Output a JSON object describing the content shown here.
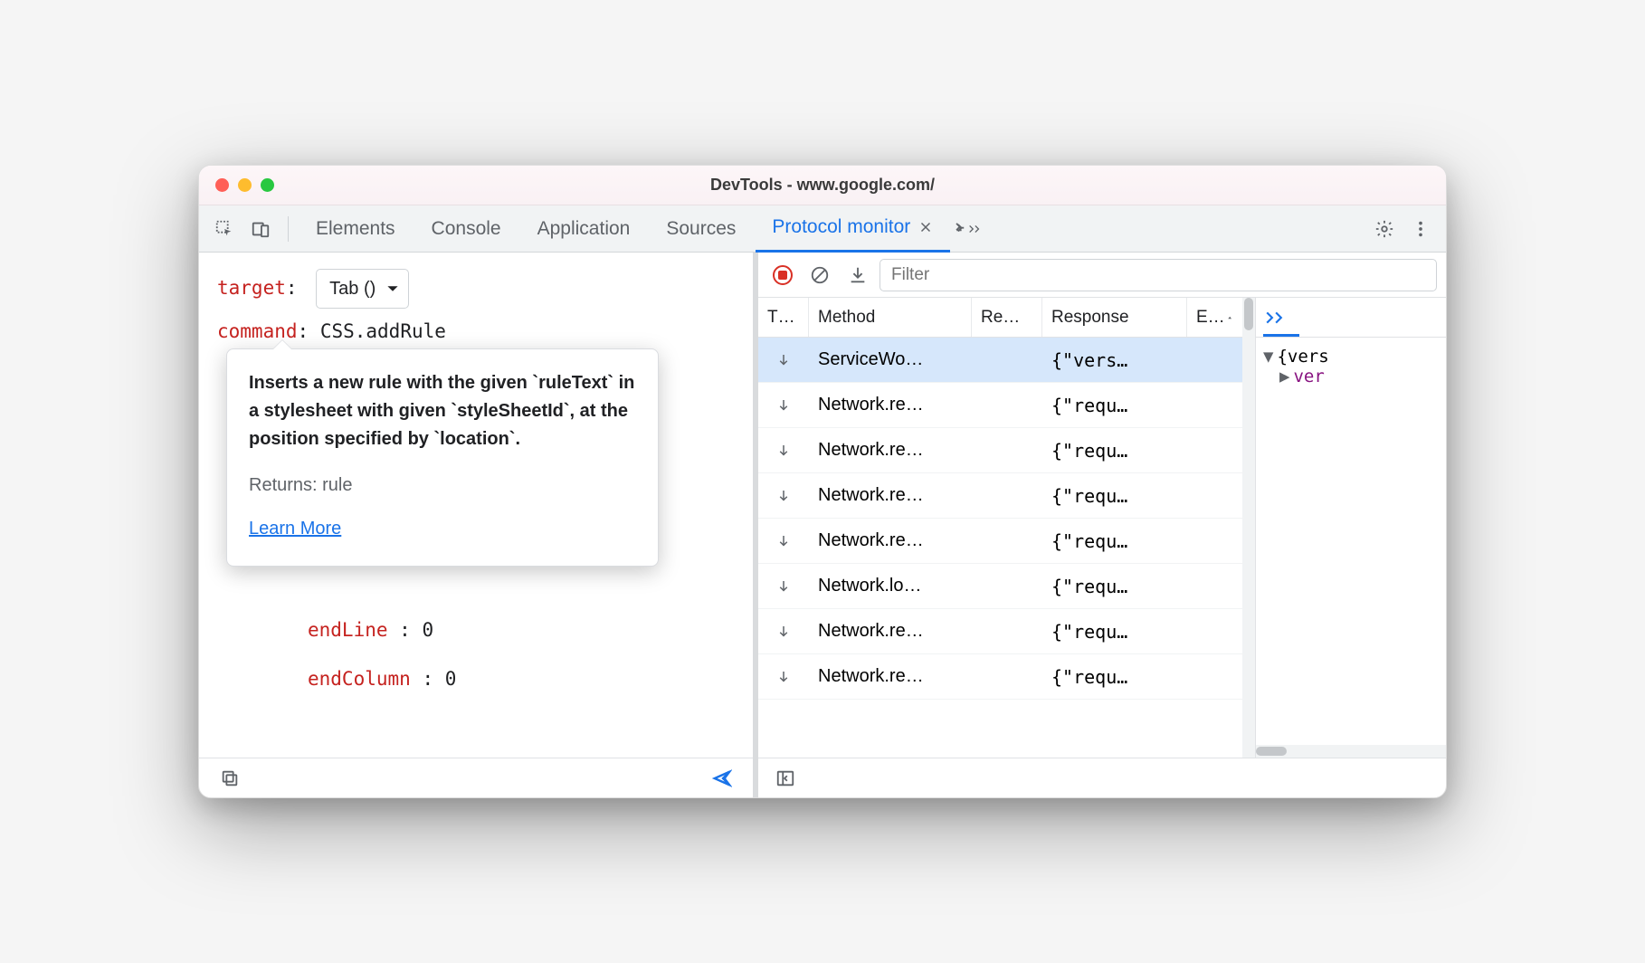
{
  "window": {
    "title": "DevTools - www.google.com/"
  },
  "tabs": {
    "items": [
      "Elements",
      "Console",
      "Application",
      "Sources",
      "Protocol monitor"
    ],
    "activeIndex": 4
  },
  "editor": {
    "targetLabel": "target",
    "targetValue": "Tab ()",
    "commandLabel": "command",
    "commandValue": "CSS.addRule",
    "params": {
      "endLineKey": "endLine",
      "endLineVal": "0",
      "endColumnKey": "endColumn",
      "endColumnVal": "0"
    }
  },
  "tooltip": {
    "description": "Inserts a new rule with the given `ruleText` in a stylesheet with given `styleSheetId`, at the position specified by `location`.",
    "returns": "Returns: rule",
    "learnMore": "Learn More"
  },
  "protocol": {
    "filterPlaceholder": "Filter",
    "columns": {
      "type": "T…",
      "method": "Method",
      "request": "Re…",
      "response": "Response",
      "elapsed": "E…"
    },
    "rows": [
      {
        "dir": "down",
        "method": "ServiceWo…",
        "request": "",
        "response": "{\"vers…",
        "selected": true
      },
      {
        "dir": "down",
        "method": "Network.re…",
        "request": "",
        "response": "{\"requ…"
      },
      {
        "dir": "down",
        "method": "Network.re…",
        "request": "",
        "response": "{\"requ…"
      },
      {
        "dir": "down",
        "method": "Network.re…",
        "request": "",
        "response": "{\"requ…"
      },
      {
        "dir": "down",
        "method": "Network.re…",
        "request": "",
        "response": "{\"requ…"
      },
      {
        "dir": "down",
        "method": "Network.lo…",
        "request": "",
        "response": "{\"requ…"
      },
      {
        "dir": "down",
        "method": "Network.re…",
        "request": "",
        "response": "{\"requ…"
      },
      {
        "dir": "down",
        "method": "Network.re…",
        "request": "",
        "response": "{\"requ…"
      }
    ]
  },
  "detail": {
    "root": "{vers",
    "childKey": "ver"
  }
}
